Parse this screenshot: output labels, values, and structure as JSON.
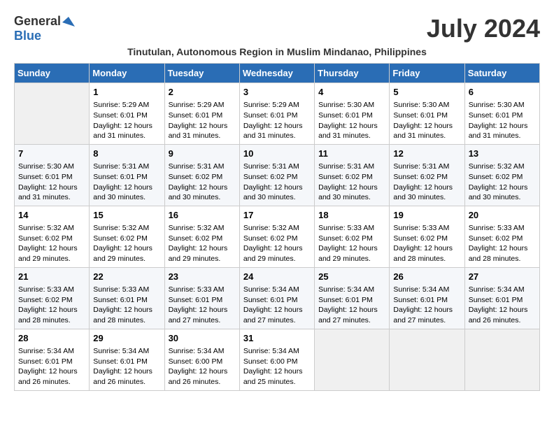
{
  "logo": {
    "line1": "General",
    "line2": "Blue"
  },
  "month_title": "July 2024",
  "subtitle": "Tinutulan, Autonomous Region in Muslim Mindanao, Philippines",
  "weekdays": [
    "Sunday",
    "Monday",
    "Tuesday",
    "Wednesday",
    "Thursday",
    "Friday",
    "Saturday"
  ],
  "weeks": [
    [
      {
        "day": "",
        "info": ""
      },
      {
        "day": "1",
        "info": "Sunrise: 5:29 AM\nSunset: 6:01 PM\nDaylight: 12 hours\nand 31 minutes."
      },
      {
        "day": "2",
        "info": "Sunrise: 5:29 AM\nSunset: 6:01 PM\nDaylight: 12 hours\nand 31 minutes."
      },
      {
        "day": "3",
        "info": "Sunrise: 5:29 AM\nSunset: 6:01 PM\nDaylight: 12 hours\nand 31 minutes."
      },
      {
        "day": "4",
        "info": "Sunrise: 5:30 AM\nSunset: 6:01 PM\nDaylight: 12 hours\nand 31 minutes."
      },
      {
        "day": "5",
        "info": "Sunrise: 5:30 AM\nSunset: 6:01 PM\nDaylight: 12 hours\nand 31 minutes."
      },
      {
        "day": "6",
        "info": "Sunrise: 5:30 AM\nSunset: 6:01 PM\nDaylight: 12 hours\nand 31 minutes."
      }
    ],
    [
      {
        "day": "7",
        "info": "Sunrise: 5:30 AM\nSunset: 6:01 PM\nDaylight: 12 hours\nand 31 minutes."
      },
      {
        "day": "8",
        "info": "Sunrise: 5:31 AM\nSunset: 6:01 PM\nDaylight: 12 hours\nand 30 minutes."
      },
      {
        "day": "9",
        "info": "Sunrise: 5:31 AM\nSunset: 6:02 PM\nDaylight: 12 hours\nand 30 minutes."
      },
      {
        "day": "10",
        "info": "Sunrise: 5:31 AM\nSunset: 6:02 PM\nDaylight: 12 hours\nand 30 minutes."
      },
      {
        "day": "11",
        "info": "Sunrise: 5:31 AM\nSunset: 6:02 PM\nDaylight: 12 hours\nand 30 minutes."
      },
      {
        "day": "12",
        "info": "Sunrise: 5:31 AM\nSunset: 6:02 PM\nDaylight: 12 hours\nand 30 minutes."
      },
      {
        "day": "13",
        "info": "Sunrise: 5:32 AM\nSunset: 6:02 PM\nDaylight: 12 hours\nand 30 minutes."
      }
    ],
    [
      {
        "day": "14",
        "info": "Sunrise: 5:32 AM\nSunset: 6:02 PM\nDaylight: 12 hours\nand 29 minutes."
      },
      {
        "day": "15",
        "info": "Sunrise: 5:32 AM\nSunset: 6:02 PM\nDaylight: 12 hours\nand 29 minutes."
      },
      {
        "day": "16",
        "info": "Sunrise: 5:32 AM\nSunset: 6:02 PM\nDaylight: 12 hours\nand 29 minutes."
      },
      {
        "day": "17",
        "info": "Sunrise: 5:32 AM\nSunset: 6:02 PM\nDaylight: 12 hours\nand 29 minutes."
      },
      {
        "day": "18",
        "info": "Sunrise: 5:33 AM\nSunset: 6:02 PM\nDaylight: 12 hours\nand 29 minutes."
      },
      {
        "day": "19",
        "info": "Sunrise: 5:33 AM\nSunset: 6:02 PM\nDaylight: 12 hours\nand 28 minutes."
      },
      {
        "day": "20",
        "info": "Sunrise: 5:33 AM\nSunset: 6:02 PM\nDaylight: 12 hours\nand 28 minutes."
      }
    ],
    [
      {
        "day": "21",
        "info": "Sunrise: 5:33 AM\nSunset: 6:02 PM\nDaylight: 12 hours\nand 28 minutes."
      },
      {
        "day": "22",
        "info": "Sunrise: 5:33 AM\nSunset: 6:01 PM\nDaylight: 12 hours\nand 28 minutes."
      },
      {
        "day": "23",
        "info": "Sunrise: 5:33 AM\nSunset: 6:01 PM\nDaylight: 12 hours\nand 27 minutes."
      },
      {
        "day": "24",
        "info": "Sunrise: 5:34 AM\nSunset: 6:01 PM\nDaylight: 12 hours\nand 27 minutes."
      },
      {
        "day": "25",
        "info": "Sunrise: 5:34 AM\nSunset: 6:01 PM\nDaylight: 12 hours\nand 27 minutes."
      },
      {
        "day": "26",
        "info": "Sunrise: 5:34 AM\nSunset: 6:01 PM\nDaylight: 12 hours\nand 27 minutes."
      },
      {
        "day": "27",
        "info": "Sunrise: 5:34 AM\nSunset: 6:01 PM\nDaylight: 12 hours\nand 26 minutes."
      }
    ],
    [
      {
        "day": "28",
        "info": "Sunrise: 5:34 AM\nSunset: 6:01 PM\nDaylight: 12 hours\nand 26 minutes."
      },
      {
        "day": "29",
        "info": "Sunrise: 5:34 AM\nSunset: 6:01 PM\nDaylight: 12 hours\nand 26 minutes."
      },
      {
        "day": "30",
        "info": "Sunrise: 5:34 AM\nSunset: 6:00 PM\nDaylight: 12 hours\nand 26 minutes."
      },
      {
        "day": "31",
        "info": "Sunrise: 5:34 AM\nSunset: 6:00 PM\nDaylight: 12 hours\nand 25 minutes."
      },
      {
        "day": "",
        "info": ""
      },
      {
        "day": "",
        "info": ""
      },
      {
        "day": "",
        "info": ""
      }
    ]
  ]
}
